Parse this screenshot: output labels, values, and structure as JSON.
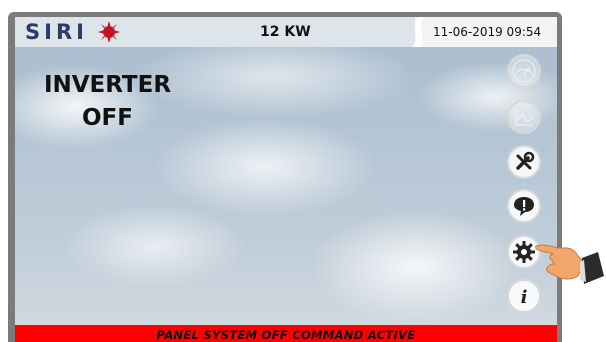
{
  "header": {
    "brand": "SIRI",
    "power": "12 KW",
    "datetime": "11-06-2019 09:54"
  },
  "main": {
    "status_line1": "INVERTER",
    "status_line2": "OFF"
  },
  "sidebar": {
    "icons": [
      "gauge-icon",
      "chart-icon",
      "tools-icon",
      "alarm-icon",
      "settings-icon",
      "info-icon"
    ]
  },
  "footer": {
    "alarm_text": "PANEL SYSTEM OFF COMMAND ACTIVE"
  },
  "colors": {
    "alarm_bar": "#ff0000",
    "topbar": "#dde4ea",
    "brand": "#2c3b6a",
    "logo_sun": "#c1121f"
  }
}
